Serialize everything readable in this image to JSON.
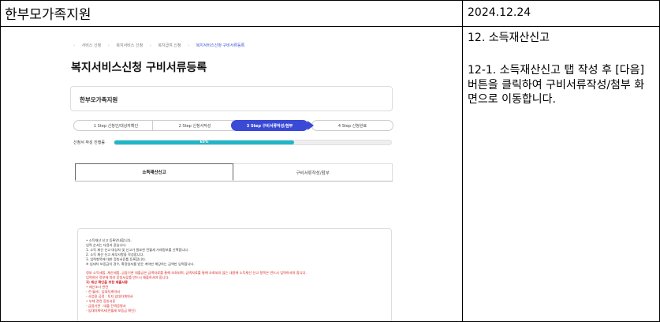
{
  "document": {
    "title": "한부모가족지원",
    "date": "2024.12.24",
    "section": "12. 소득재산신고",
    "description": "12-1. 소득재산신고 탭 작성 후 [다음] 버튼을 클릭하여 구비서류작성/첨부 화면으로 이동합니다."
  },
  "screenshot": {
    "breadcrumb": [
      "서비스 신청",
      "복지서비스 신청",
      "복지급여 신청",
      "복지서비스신청 구비서류등록"
    ],
    "page_title": "복지서비스신청 구비서류등록",
    "org_name": "한부모가족지원",
    "steps": [
      {
        "label": "1 Step 신청인/대상자확인"
      },
      {
        "label": "2 Step 신청서작성"
      },
      {
        "label": "3 Step 구비서류작성/첨부"
      },
      {
        "label": "4 Step 신청완료"
      }
    ],
    "progress": {
      "label": "신청서 작성 진행률",
      "value": 65,
      "text": "65%"
    },
    "tabs": [
      {
        "label": "소득재산신고",
        "active": true
      },
      {
        "label": "구비서류작성/첨부",
        "active": false
      }
    ],
    "notice_lines": [
      {
        "text": "• 소득재산 신고 등록안내합니다.",
        "style": ""
      },
      {
        "text": "  입력 순서는 다음과 같습니다.",
        "style": ""
      },
      {
        "text": "  1. 소득 재산 신고 대상자 및 신고가 필요한 전월세 거래정보를 선택합니다.",
        "style": ""
      },
      {
        "text": "  2. 소득 재산 신고 세부사항을 작성합니다.",
        "style": ""
      },
      {
        "text": "  3. 입력항목에 대한 증빙서류를 등록합니다.",
        "style": ""
      },
      {
        "text": "  ※ 임대차 보증금의 경우, 확정일자를 받은 계약만 해당하는 금액만 입력합니다.",
        "style": ""
      },
      {
        "text": "",
        "style": "gap"
      },
      {
        "text": "  정보 소득세법, 재산세법, 금융기관 대출금은 금액자료를 통해 조회되며, 금액자료를 통해 조회되지 않는 내용에 소득재산 신고 항목은 반드시 입력하셔야 합니다.",
        "style": "red"
      },
      {
        "text": "  입력하신 정보에 따라 증빙서류를 반드시 제출하셔야 합니다.",
        "style": "red"
      },
      {
        "text": "  1) 재산 확인을 위한 제출서류",
        "style": "red bold"
      },
      {
        "text": "  • 재산조사 관련",
        "style": "red"
      },
      {
        "text": "    - 전·월세 : 임대차계약서",
        "style": "red"
      },
      {
        "text": "    - 사업용 공정 : 토지 임대차계약서",
        "style": "red"
      },
      {
        "text": "  • 부채 관련 증빙서류",
        "style": "red"
      },
      {
        "text": "    - 금융기관 : 대출 잔액증명서",
        "style": "red"
      },
      {
        "text": "    - 임대차계약서(전월세 보증금 확인)",
        "style": "red"
      }
    ]
  }
}
